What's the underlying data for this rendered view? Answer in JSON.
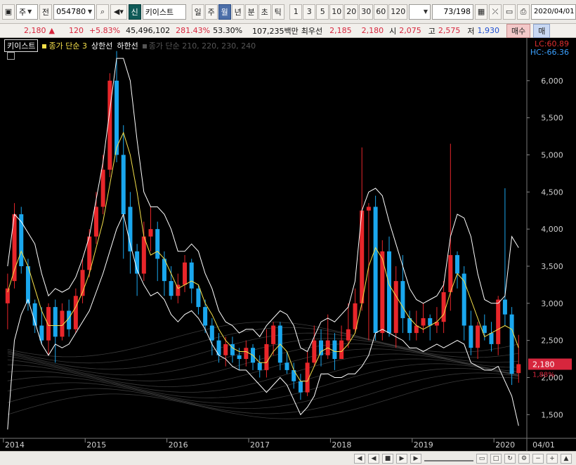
{
  "toolbar": {
    "market": "주",
    "prev_label": "전",
    "code": "054780",
    "badge": "신",
    "stock_name": "키이스트",
    "periods": [
      "일",
      "주",
      "월",
      "년",
      "분",
      "초",
      "틱"
    ],
    "active_period": "월",
    "numbers": [
      "1",
      "3",
      "5",
      "10",
      "20",
      "30",
      "60",
      "120"
    ],
    "page": "73",
    "page_total": "/198",
    "date": "2020/04/01"
  },
  "quote": {
    "price": "2,180",
    "change_arrow": "▲",
    "change": "120",
    "change_pct": "+5.83%",
    "volume": "45,496,102",
    "vol_pct": "281.43%",
    "turnover_pct": "53.30%",
    "amount": "107,235백만",
    "best_ask_label": "최우선",
    "best_ask": "2,185",
    "best_bid": "2,180",
    "open_label": "시",
    "open": "2,075",
    "high_label": "고",
    "high": "2,575",
    "low_label": "저",
    "low": "1,930",
    "buy_label": "매수",
    "sell_label": "매"
  },
  "legend": {
    "name": "키이스트",
    "ma_label": "종가 단순 3",
    "upper_label": "상한선",
    "lower_label": "하한선",
    "ma_group_label": "종가 단순 210, 220, 230, 240"
  },
  "indicators": {
    "lc": "LC:60.89",
    "hc": "HC:-66.36"
  },
  "last_price_tag": "2,180",
  "last_price_tag2": "1,88%",
  "chart_data": {
    "type": "candlestick",
    "x_ticks": [
      "2014",
      "2015",
      "2016",
      "2017",
      "2018",
      "2019",
      "2020"
    ],
    "x_right_label": "04/01",
    "y_ticks": [
      "1,500",
      "2,000",
      "2,500",
      "3,000",
      "3,500",
      "4,000",
      "4,500",
      "5,000",
      "5,500",
      "6,000"
    ],
    "ylim": [
      1200,
      6500
    ],
    "colors": {
      "up": "#e8262a",
      "down": "#1aa7ee",
      "ma": "#f5e04a",
      "band": "#ffffff",
      "ma_long": "#3a3a3a"
    },
    "candles": [
      [
        3000,
        3200,
        3400,
        2650
      ],
      [
        3300,
        4200,
        4350,
        3200
      ],
      [
        4200,
        3500,
        4300,
        3400
      ],
      [
        3500,
        3000,
        3600,
        2900
      ],
      [
        3000,
        2700,
        3050,
        2600
      ],
      [
        2700,
        2500,
        2950,
        2450
      ],
      [
        2500,
        2950,
        3000,
        2300
      ],
      [
        2950,
        2550,
        3050,
        2200
      ],
      [
        2550,
        2900,
        3000,
        2500
      ],
      [
        2900,
        2650,
        3050,
        2550
      ],
      [
        2650,
        3100,
        3200,
        2600
      ],
      [
        3100,
        3450,
        3600,
        3000
      ],
      [
        3450,
        3900,
        4000,
        3350
      ],
      [
        3900,
        4300,
        4500,
        3800
      ],
      [
        4300,
        4800,
        5000,
        4200
      ],
      [
        4800,
        6000,
        6100,
        4700
      ],
      [
        6000,
        5000,
        6400,
        4900
      ],
      [
        5000,
        4200,
        5400,
        3600
      ],
      [
        4300,
        3700,
        4500,
        3400
      ],
      [
        3700,
        3400,
        3800,
        3100
      ],
      [
        3400,
        3900,
        4100,
        3300
      ],
      [
        3900,
        4000,
        4300,
        3700
      ],
      [
        4000,
        3600,
        4100,
        3300
      ],
      [
        3600,
        3300,
        3700,
        3100
      ],
      [
        3300,
        3100,
        3500,
        3050
      ],
      [
        3100,
        3250,
        3400,
        3000
      ],
      [
        3250,
        3550,
        3650,
        3150
      ],
      [
        3550,
        3200,
        3600,
        3000
      ],
      [
        3200,
        2950,
        3250,
        2850
      ],
      [
        2950,
        2700,
        3050,
        2600
      ],
      [
        2700,
        2500,
        2800,
        2300
      ],
      [
        2500,
        2300,
        2600,
        2200
      ],
      [
        2300,
        2450,
        2550,
        2150
      ],
      [
        2450,
        2300,
        2550,
        2200
      ],
      [
        2300,
        2250,
        2400,
        2100
      ],
      [
        2250,
        2400,
        2500,
        2150
      ],
      [
        2400,
        2200,
        2450,
        2100
      ],
      [
        2200,
        2100,
        2300,
        2000
      ],
      [
        2100,
        2450,
        2650,
        2000
      ],
      [
        2450,
        2700,
        2750,
        2300
      ],
      [
        2700,
        2200,
        2750,
        2100
      ],
      [
        2200,
        2100,
        2350,
        2050
      ],
      [
        2100,
        1950,
        2200,
        1850
      ],
      [
        1950,
        1800,
        2050,
        1700
      ],
      [
        1800,
        2200,
        2350,
        1750
      ],
      [
        2200,
        2500,
        2700,
        2150
      ],
      [
        2500,
        2300,
        2650,
        2150
      ],
      [
        2300,
        2500,
        2850,
        2250
      ],
      [
        2500,
        2250,
        2600,
        2100
      ],
      [
        2250,
        2500,
        2700,
        2250
      ],
      [
        2500,
        2650,
        3000,
        2400
      ],
      [
        2650,
        3000,
        3200,
        2600
      ],
      [
        3000,
        4250,
        5100,
        2900
      ],
      [
        4250,
        4300,
        4350,
        2500
      ],
      [
        4300,
        2600,
        4450,
        2500
      ],
      [
        2600,
        3700,
        3850,
        2500
      ],
      [
        3700,
        2600,
        3900,
        2550
      ],
      [
        2600,
        3300,
        3500,
        2400
      ],
      [
        3300,
        2800,
        3650,
        2600
      ],
      [
        2800,
        2600,
        2900,
        2500
      ],
      [
        2600,
        2700,
        2900,
        2500
      ],
      [
        2700,
        2800,
        3000,
        2600
      ],
      [
        2800,
        2700,
        2850,
        2500
      ],
      [
        2700,
        2750,
        2950,
        2600
      ],
      [
        2750,
        3150,
        3300,
        2600
      ],
      [
        3150,
        3650,
        5150,
        2900
      ],
      [
        3650,
        3400,
        3700,
        3200
      ],
      [
        3400,
        2700,
        3500,
        2500
      ],
      [
        2700,
        2400,
        2900,
        2300
      ],
      [
        2400,
        2700,
        2750,
        2250
      ],
      [
        2700,
        2600,
        2850,
        2500
      ],
      [
        2600,
        2450,
        2750,
        2350
      ],
      [
        2450,
        3050,
        3100,
        2300
      ],
      [
        3050,
        2850,
        4550,
        2700
      ],
      [
        2850,
        2050,
        2950,
        1900
      ],
      [
        2060,
        2180,
        2575,
        1930
      ]
    ],
    "ma3": [
      3150,
      3450,
      3700,
      3500,
      3200,
      2900,
      2700,
      2700,
      2700,
      2800,
      2950,
      3150,
      3400,
      3750,
      4100,
      4600,
      5100,
      5300,
      5000,
      4500,
      3900,
      3650,
      3700,
      3600,
      3400,
      3200,
      3250,
      3300,
      3250,
      3000,
      2850,
      2650,
      2500,
      2400,
      2350,
      2350,
      2300,
      2200,
      2200,
      2350,
      2450,
      2350,
      2100,
      1950,
      1950,
      2150,
      2350,
      2400,
      2350,
      2350,
      2450,
      2600,
      3000,
      3500,
      3750,
      3600,
      3250,
      3100,
      2950,
      2800,
      2700,
      2650,
      2700,
      2750,
      2850,
      3150,
      3400,
      3300,
      3050,
      2800,
      2550,
      2600,
      2650,
      2700,
      2650,
      2400
    ],
    "upper": [
      3500,
      4200,
      4100,
      3950,
      3800,
      3400,
      3100,
      3200,
      3150,
      3200,
      3350,
      3600,
      3900,
      4400,
      4900,
      5600,
      6300,
      6300,
      6000,
      5200,
      4500,
      4300,
      4300,
      4200,
      4000,
      3700,
      3700,
      3800,
      3700,
      3400,
      3200,
      2900,
      2750,
      2700,
      2600,
      2650,
      2650,
      2550,
      2700,
      2800,
      2900,
      2850,
      2700,
      2400,
      2350,
      2550,
      2750,
      2800,
      2750,
      2850,
      2950,
      3300,
      4250,
      4500,
      4550,
      4450,
      4100,
      3800,
      3500,
      3200,
      3050,
      3000,
      3050,
      3100,
      3250,
      3900,
      4200,
      4150,
      3900,
      3400,
      3050,
      3000,
      3000,
      3100,
      3900,
      3750
    ],
    "lower": [
      1300,
      2500,
      2850,
      3050,
      2750,
      2450,
      2300,
      2450,
      2400,
      2450,
      2600,
      2750,
      2900,
      3150,
      3400,
      3700,
      4000,
      4200,
      3800,
      3450,
      3250,
      3100,
      3150,
      3050,
      2850,
      2750,
      2850,
      2900,
      2800,
      2650,
      2450,
      2300,
      2250,
      2150,
      2100,
      2100,
      2000,
      1900,
      1800,
      1900,
      2000,
      1900,
      1700,
      1500,
      1600,
      1750,
      2050,
      2050,
      2000,
      2000,
      2050,
      2050,
      2150,
      2300,
      2600,
      2650,
      2600,
      2550,
      2500,
      2400,
      2400,
      2350,
      2400,
      2450,
      2400,
      2450,
      2500,
      2450,
      2200,
      2150,
      2100,
      2100,
      2150,
      1950,
      1750,
      1350
    ]
  }
}
